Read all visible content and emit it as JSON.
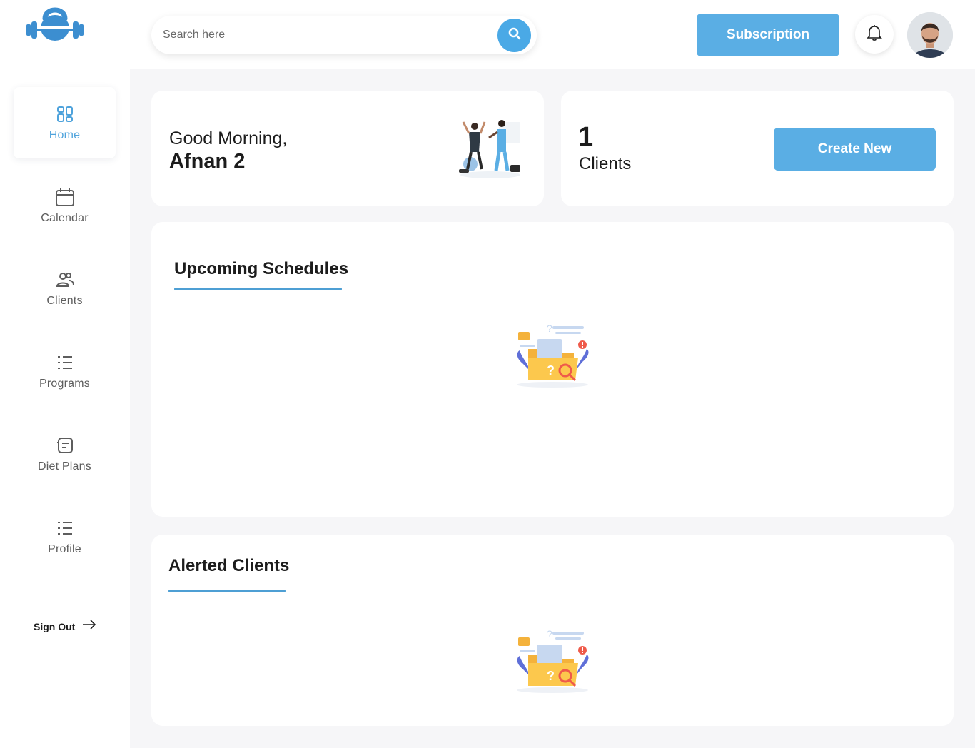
{
  "sidebar": {
    "items": [
      {
        "label": "Home",
        "icon": "dashboard-icon",
        "active": true
      },
      {
        "label": "Calendar",
        "icon": "calendar-icon"
      },
      {
        "label": "Clients",
        "icon": "users-icon"
      },
      {
        "label": "Programs",
        "icon": "list-icon"
      },
      {
        "label": "Diet Plans",
        "icon": "document-icon"
      },
      {
        "label": "Profile",
        "icon": "list-icon"
      }
    ],
    "signout_label": "Sign Out",
    "logo_icon": "kettlebell-logo-icon"
  },
  "topbar": {
    "search_placeholder": "Search here",
    "subscription_label": "Subscription"
  },
  "greeting": {
    "line1": "Good Morning,",
    "name": "Afnan 2"
  },
  "clients_summary": {
    "count": "1",
    "label": "Clients",
    "create_label": "Create New"
  },
  "sections": {
    "upcoming_title": "Upcoming Schedules",
    "alerted_title": "Alerted Clients"
  },
  "colors": {
    "accent": "#5aaee4",
    "accent_dark": "#4e9fd4",
    "logo": "#3c8ed0",
    "background": "#f6f6f8"
  }
}
